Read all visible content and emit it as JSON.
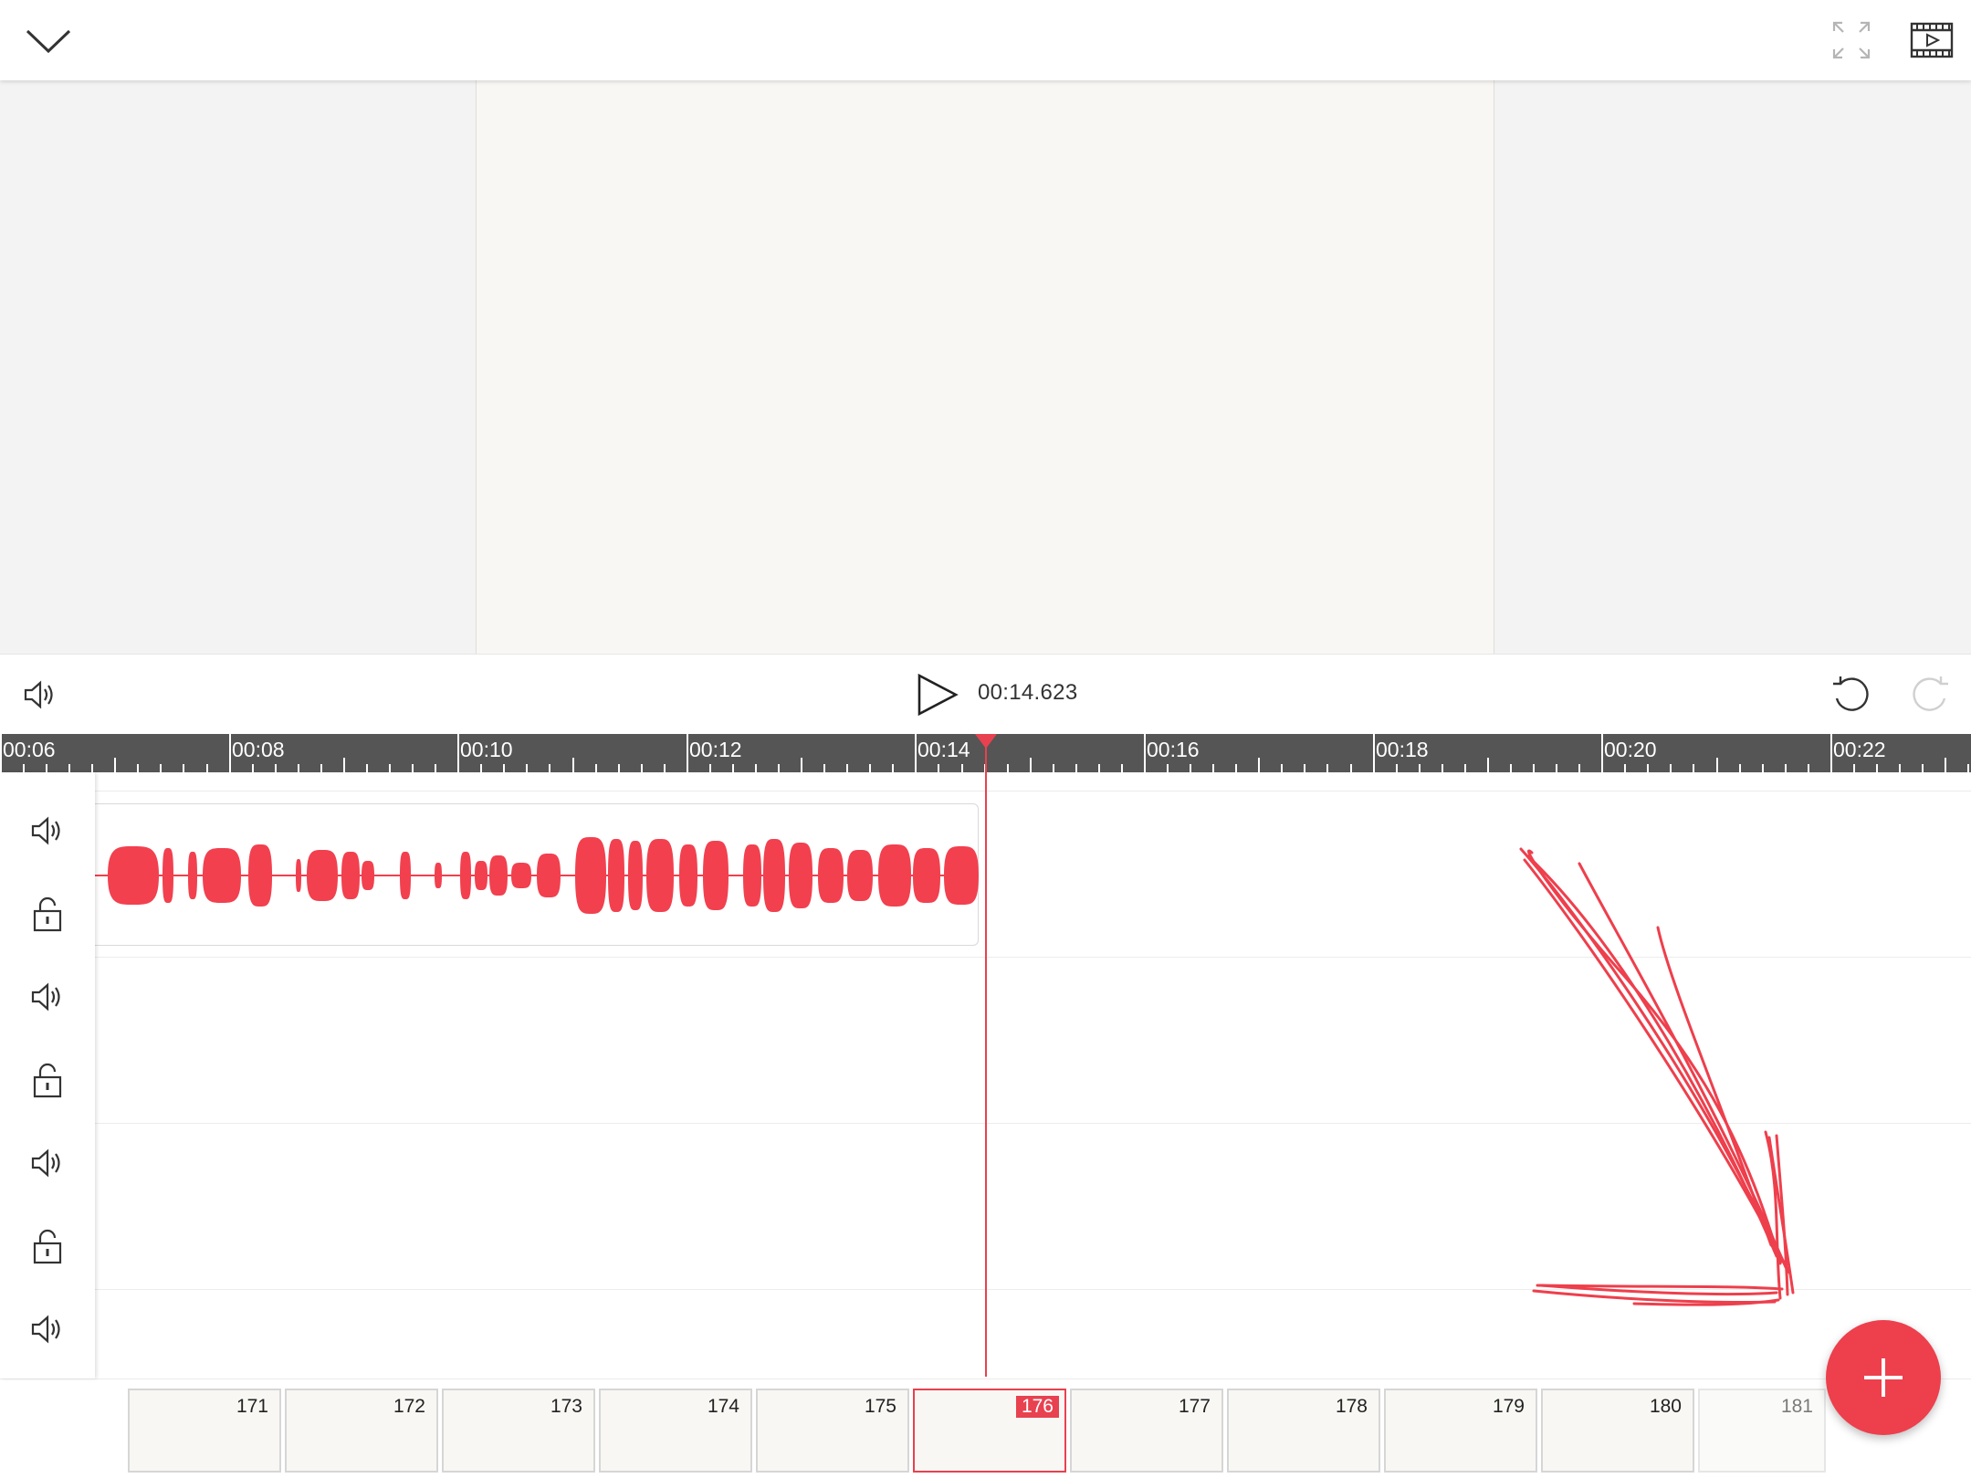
{
  "transport": {
    "timecode": "00:14.623"
  },
  "ruler": {
    "labels": [
      "00:06",
      "00:08",
      "00:10",
      "00:12",
      "00:14",
      "00:16",
      "00:18",
      "00:20",
      "00:22"
    ]
  },
  "frames": [
    {
      "number": "171"
    },
    {
      "number": "172"
    },
    {
      "number": "173"
    },
    {
      "number": "174"
    },
    {
      "number": "175"
    },
    {
      "number": "176",
      "selected": true
    },
    {
      "number": "177"
    },
    {
      "number": "178"
    },
    {
      "number": "179"
    },
    {
      "number": "180"
    },
    {
      "number": "181"
    }
  ],
  "colors": {
    "accent": "#ee3f4c",
    "ruler_bg": "#555555",
    "waveform": "#f2404f"
  },
  "icons": {
    "collapse": "chevron-down-icon",
    "fullscreen": "fullscreen-icon",
    "movie": "movie-icon",
    "volume": "volume-icon",
    "play": "play-icon",
    "undo": "undo-icon",
    "redo": "redo-icon",
    "lock": "lock-open-icon",
    "add": "plus-icon"
  }
}
